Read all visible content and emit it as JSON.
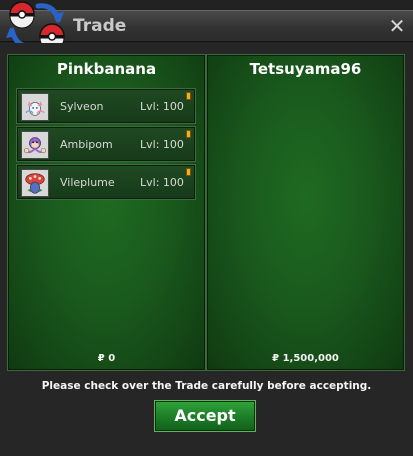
{
  "window": {
    "title": "Trade"
  },
  "left_trader": {
    "name": "Pinkbanana",
    "money": "₽ 0",
    "pokemon": [
      {
        "name": "Sylveon",
        "level": "Lvl: 100"
      },
      {
        "name": "Ambipom",
        "level": "Lvl: 100"
      },
      {
        "name": "Vileplume",
        "level": "Lvl: 100"
      }
    ]
  },
  "right_trader": {
    "name": "Tetsuyama96",
    "money": "₽ 1,500,000",
    "pokemon": []
  },
  "notice": "Please check over the Trade carefully before accepting.",
  "actions": {
    "accept_label": "Accept"
  },
  "colors": {
    "panel_green": "#1a5a1d",
    "accept_green": "#1c7c27",
    "badge_orange": "#f0b020"
  },
  "icons": [
    "pokeball-logo-icon",
    "close-icon",
    "sylveon-icon",
    "ambipom-icon",
    "vileplume-icon"
  ]
}
